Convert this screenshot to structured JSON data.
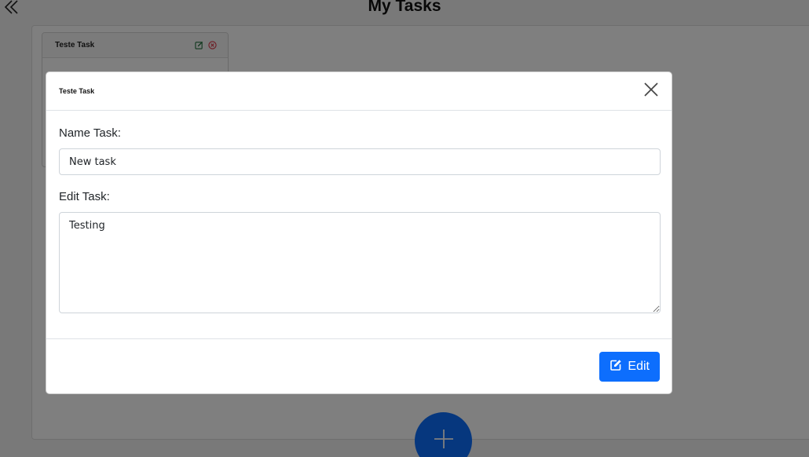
{
  "header": {
    "title": "My Tasks",
    "back_icon": "double-chevron-left-icon"
  },
  "task_card": {
    "title": "Teste Task",
    "edit_icon": "edit-icon",
    "delete_icon": "circle-x-icon"
  },
  "fab": {
    "icon": "plus-icon"
  },
  "modal": {
    "title": "Teste Task",
    "close_icon": "close-icon",
    "name_label": "Name Task:",
    "name_value": "New task",
    "desc_label": "Edit Task:",
    "desc_value": "Testing",
    "submit_label": "Edit",
    "submit_icon": "edit-icon"
  },
  "colors": {
    "primary": "#0d6efd",
    "danger": "#dc3545",
    "backdrop": "rgba(0,0,0,0.5)"
  }
}
